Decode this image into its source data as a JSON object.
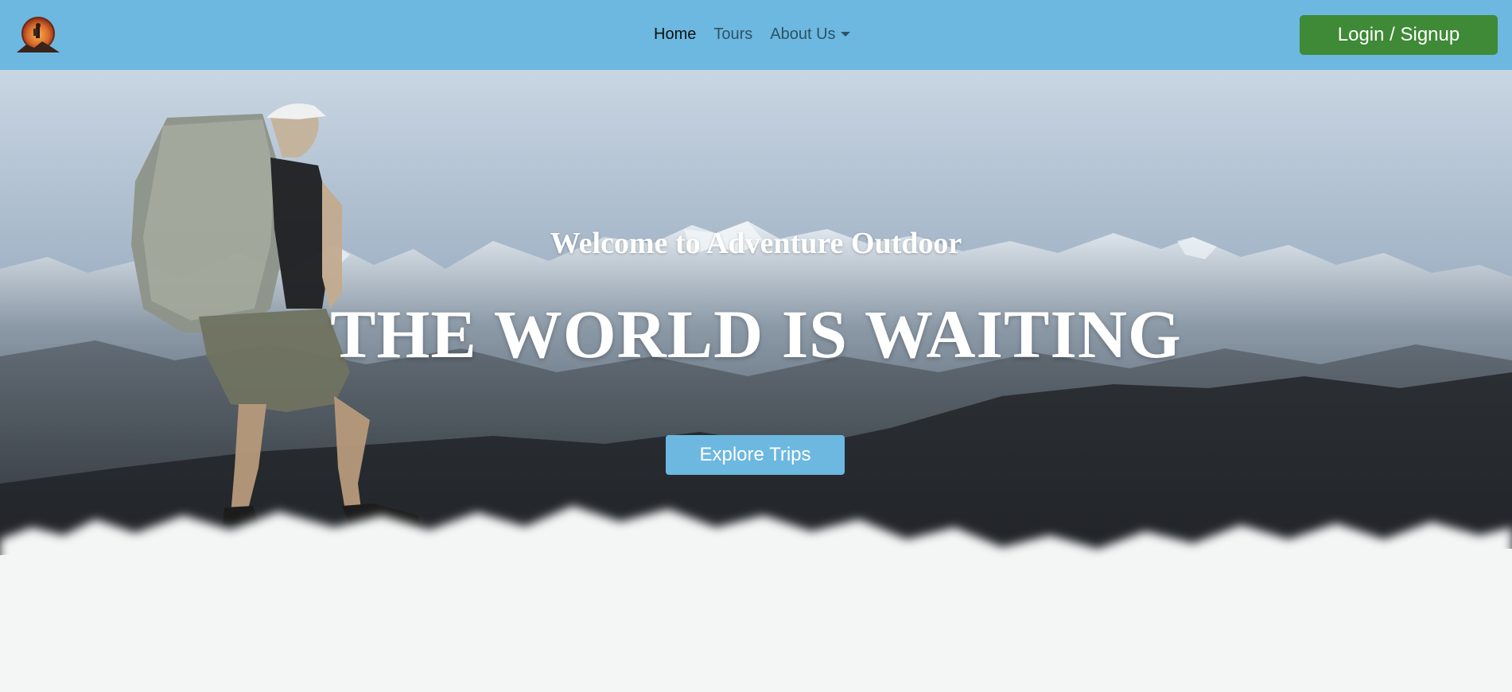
{
  "navbar": {
    "logo_icon": "hiker-logo-icon",
    "links": [
      {
        "label": "Home",
        "active": true
      },
      {
        "label": "Tours",
        "active": false
      },
      {
        "label": "About Us",
        "active": false,
        "dropdown": true
      }
    ],
    "login_label": "Login / Signup"
  },
  "hero": {
    "subtitle": "Welcome to Adventure Outdoor",
    "title": "THE WORLD IS WAITING",
    "cta_label": "Explore Trips"
  },
  "colors": {
    "navbar_bg": "#6cb8e0",
    "login_button": "#3f8a36",
    "cta_button": "#6cb8e0"
  }
}
